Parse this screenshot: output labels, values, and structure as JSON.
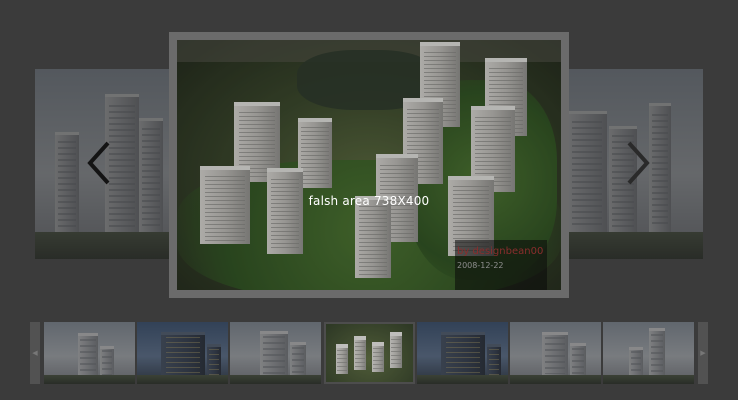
{
  "viewer": {
    "overlay_label": "falsh area 738X400",
    "caption": {
      "author": "by designbean00",
      "date": "2008-12-22"
    }
  },
  "navigation": {
    "prev_icon": "chevron-left-icon",
    "next_icon": "chevron-right-icon"
  },
  "thumbnail_strip": {
    "prev_icon": "triangle-left-icon",
    "next_icon": "triangle-right-icon",
    "prev_glyph": "◀",
    "next_glyph": "▶",
    "selected_index": 3,
    "count": 7
  },
  "colors": {
    "background": "#3b3b3b",
    "caption_author": "#8a2d2d",
    "caption_date": "#8e8e8e",
    "overlay_text": "#ffffff"
  }
}
